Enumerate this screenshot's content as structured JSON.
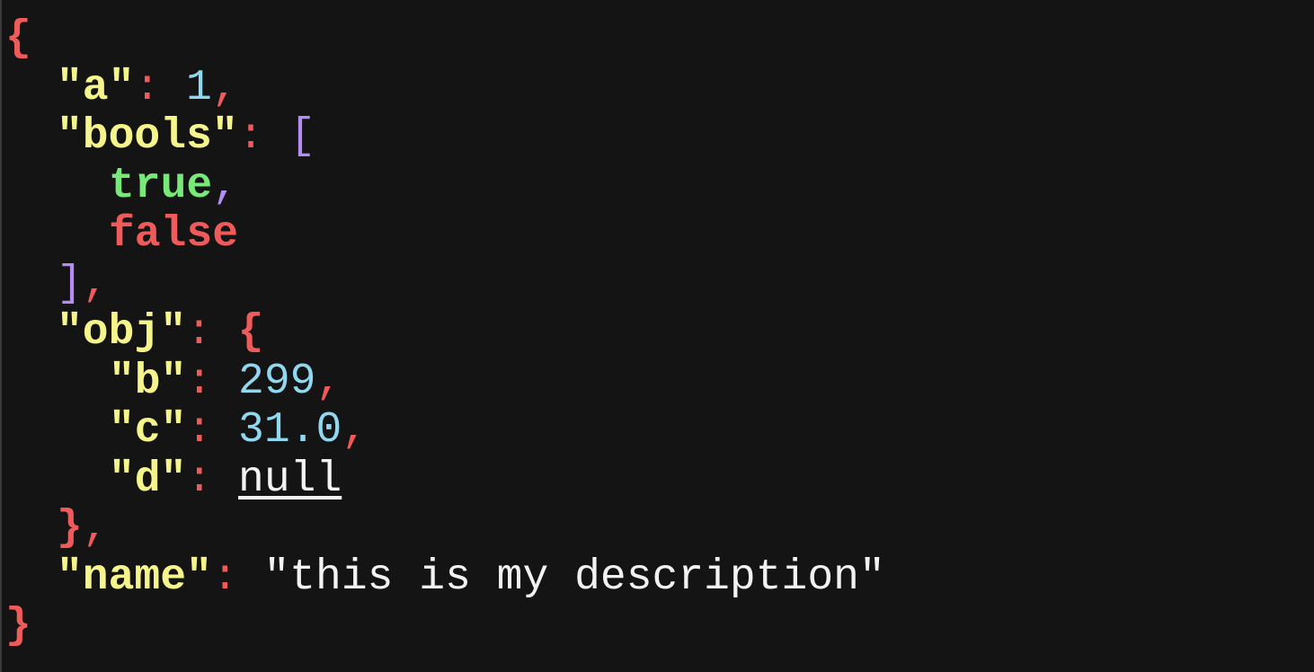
{
  "colors": {
    "background": "#141414",
    "brace": "#ef5a5a",
    "bracket": "#b48cf2",
    "key": "#f5f58c",
    "number": "#8fd8f0",
    "true": "#78e878",
    "false": "#ef5a5a",
    "string": "#f2f2f2"
  },
  "json": {
    "open_brace": "{",
    "close_brace": "}",
    "colon": ": ",
    "comma": ",",
    "a": {
      "key": "\"a\"",
      "value": "1"
    },
    "bools": {
      "key": "\"bools\"",
      "open": "[",
      "close": "]",
      "items": [
        "true",
        "false"
      ]
    },
    "obj": {
      "key": "\"obj\"",
      "open": "{",
      "close": "}",
      "b": {
        "key": "\"b\"",
        "value": "299"
      },
      "c": {
        "key": "\"c\"",
        "value": "31.0"
      },
      "d": {
        "key": "\"d\"",
        "value": "null"
      }
    },
    "name": {
      "key": "\"name\"",
      "value": "\"this is my description\""
    }
  }
}
